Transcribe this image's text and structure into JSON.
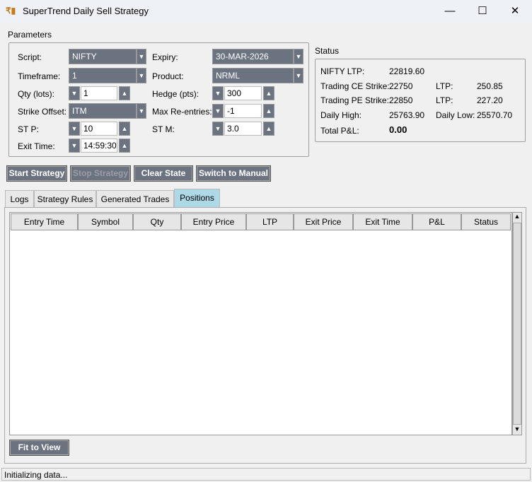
{
  "window": {
    "title": "SuperTrend Daily Sell Strategy",
    "minimize": "—",
    "maximize": "☐",
    "close": "✕"
  },
  "parameters": {
    "title": "Parameters",
    "script_label": "Script:",
    "script": "NIFTY",
    "expiry_label": "Expiry:",
    "expiry": "30-MAR-2026",
    "timeframe_label": "Timeframe:",
    "timeframe": "1",
    "product_label": "Product:",
    "product": "NRML",
    "qty_label": "Qty (lots):",
    "qty": "1",
    "hedge_label": "Hedge (pts):",
    "hedge": "300",
    "strike_label": "Strike Offset:",
    "strike": "ITM",
    "reentries_label": "Max Re-entries:",
    "reentries": "-1",
    "stp_label": "ST P:",
    "stp": "10",
    "stm_label": "ST M:",
    "stm": "3.0",
    "exit_label": "Exit Time:",
    "exit": "14:59:30"
  },
  "status": {
    "title": "Status",
    "nifty_label": "NIFTY LTP:",
    "nifty": "22819.60",
    "ce_label": "Trading CE Strike:",
    "ce": "22750",
    "ce_ltp_label": "LTP:",
    "ce_ltp": "250.85",
    "pe_label": "Trading PE Strike:",
    "pe": "22850",
    "pe_ltp_label": "LTP:",
    "pe_ltp": "227.20",
    "high_label": "Daily High:",
    "high": "25763.90",
    "low_label": "Daily Low:",
    "low": "25570.70",
    "pnl_label": "Total P&L:",
    "pnl": "0.00"
  },
  "buttons": {
    "start": "Start Strategy",
    "stop": "Stop Strategy",
    "clear": "Clear State",
    "manual": "Switch to Manual",
    "fit": "Fit to View"
  },
  "tabs": [
    "Logs",
    "Strategy Rules",
    "Generated Trades",
    "Positions"
  ],
  "columns": [
    "Entry Time",
    "Symbol",
    "Qty",
    "Entry Price",
    "LTP",
    "Exit Price",
    "Exit Time",
    "P&L",
    "Status"
  ],
  "statusbar": "Initializing data..."
}
